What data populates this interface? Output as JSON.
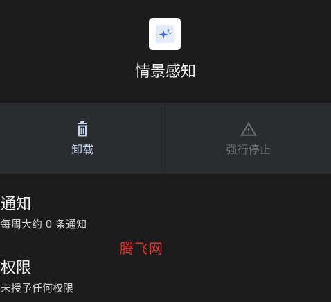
{
  "app": {
    "name": "情景感知",
    "icon": "sparkle-icon"
  },
  "actions": [
    {
      "label": "卸载",
      "icon": "trash-icon",
      "enabled": true
    },
    {
      "label": "强行停止",
      "icon": "warning-icon",
      "enabled": false
    }
  ],
  "notifications": {
    "title": "通知",
    "summary": "每周大约 0 条通知"
  },
  "permissions": {
    "title": "权限",
    "summary": "未授予任何权限"
  },
  "watermark": "腾飞网",
  "colors": {
    "bg": "#1c1c1c",
    "bar_bg": "#2a2c30",
    "accent": "#c6d5f0",
    "disabled": "#6a6d72",
    "text_primary": "#f0f0f0",
    "text_secondary": "#d2d2d2",
    "watermark": "#e0302a",
    "icon_blue": "#3b6fe6",
    "icon_tile": "#e2eafb"
  }
}
